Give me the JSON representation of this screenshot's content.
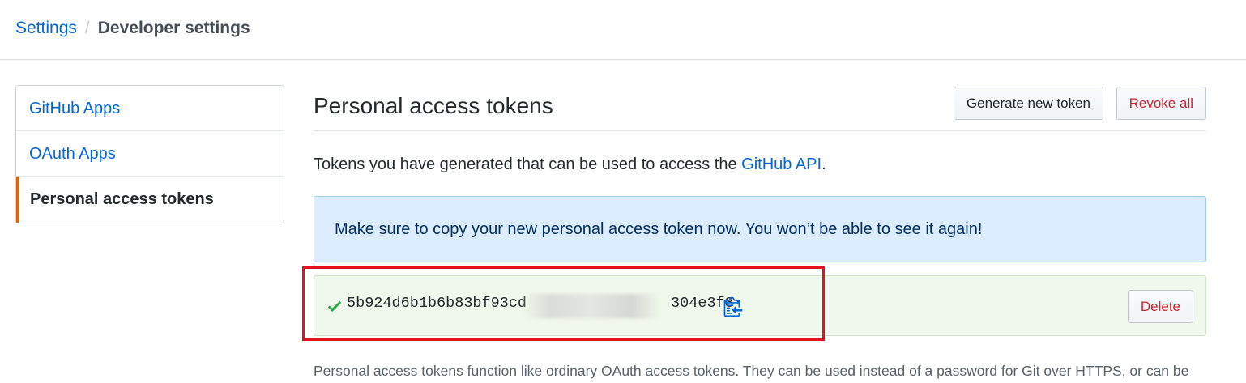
{
  "breadcrumb": {
    "parent": "Settings",
    "separator": "/",
    "current": "Developer settings"
  },
  "sidebar": {
    "items": [
      {
        "label": "GitHub Apps",
        "selected": false
      },
      {
        "label": "OAuth Apps",
        "selected": false
      },
      {
        "label": "Personal access tokens",
        "selected": true
      }
    ]
  },
  "main": {
    "title": "Personal access tokens",
    "generate_label": "Generate new token",
    "revoke_label": "Revoke all",
    "intro_prefix": "Tokens you have generated that can be used to access the ",
    "intro_link": "GitHub API",
    "intro_suffix": ".",
    "flash_message": "Make sure to copy your new personal access token now. You won’t be able to see it again!",
    "token": {
      "visible_start": "5b924d6b1b6b83bf93cd",
      "visible_end": "304e3f8",
      "obscured": true,
      "delete_label": "Delete"
    },
    "footnote": "Personal access tokens function like ordinary OAuth access tokens. They can be used instead of a password for Git over HTTPS, or can be"
  },
  "colors": {
    "link": "#0366d6",
    "danger": "#cb2431",
    "selected_accent": "#e36209",
    "flash_bg": "#dbedff",
    "token_bg": "#f0f7ec",
    "check": "#28a745",
    "highlight": "#e0141c"
  },
  "icons": {
    "check": "check-icon",
    "copy": "clippy-icon"
  }
}
